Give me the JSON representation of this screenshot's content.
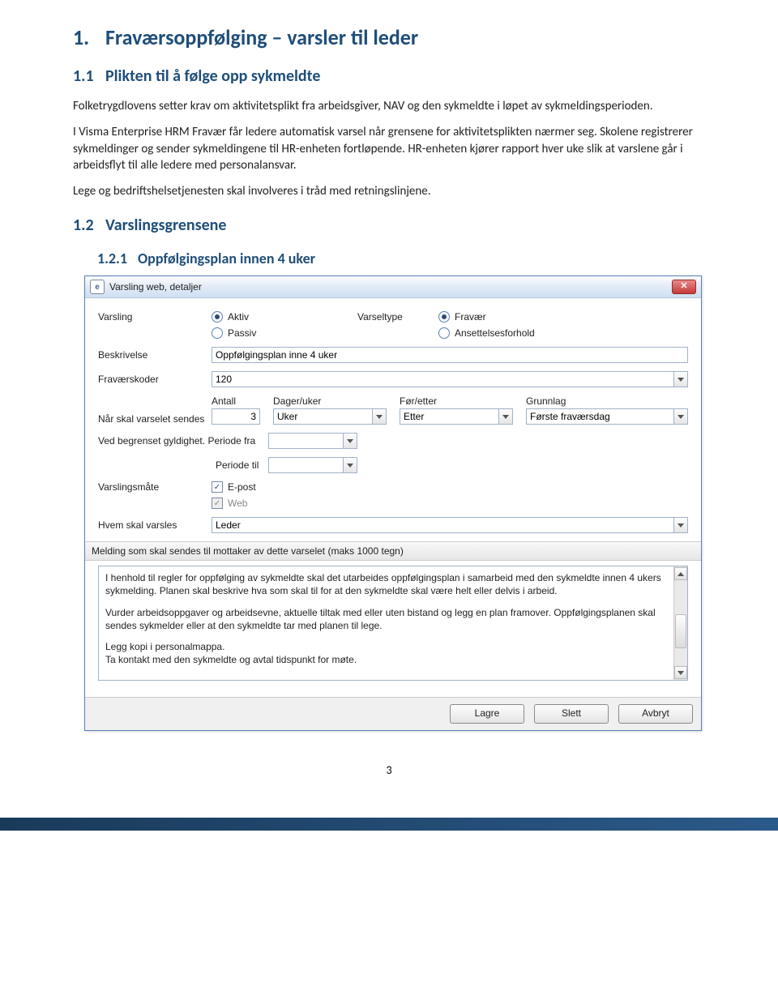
{
  "doc": {
    "h1_num": "1.",
    "h1_title": "Fraværsoppfølging – varsler til leder",
    "h2_num": "1.1",
    "h2_title": "Plikten til å følge opp sykmeldte",
    "para1": "Folketrygdlovens setter krav om aktivitetsplikt fra arbeidsgiver, NAV og den sykmeldte i løpet av sykmeldingsperioden.",
    "para2": "I Visma Enterprise HRM Fravær får ledere automatisk varsel når grensene for aktivitetsplikten nærmer seg.  Skolene registrerer sykmeldinger og sender sykmeldingene til HR-enheten fortløpende. HR-enheten kjører rapport hver uke slik at varslene går i arbeidsflyt til alle ledere med personalansvar.",
    "para3": "Lege og bedriftshelsetjenesten skal involveres i tråd med retningslinjene.",
    "h3_num": "1.2",
    "h3_title": "Varslingsgrensene",
    "h4_num": "1.2.1",
    "h4_title": "Oppfølgingsplan innen 4 uker",
    "page_number": "3"
  },
  "dialog": {
    "title": "Varsling web, detaljer",
    "labels": {
      "varsling": "Varsling",
      "varseltype": "Varseltype",
      "beskrivelse": "Beskrivelse",
      "fravaerskoder": "Fraværskoder",
      "naar": "Når skal varselet sendes",
      "ved_begrenset": "Ved begrenset gyldighet.",
      "periode_fra": "Periode fra",
      "periode_til": "Periode til",
      "varslingsmaate": "Varslingsmåte",
      "hvem": "Hvem skal varsles",
      "melding_header": "Melding som skal sendes til mottaker av dette varselet (maks 1000 tegn)"
    },
    "radios": {
      "aktiv": "Aktiv",
      "passiv": "Passiv",
      "fravar": "Fravær",
      "ansettelse": "Ansettelsesforhold"
    },
    "cols": {
      "antall": "Antall",
      "dager_uker": "Dager/uker",
      "for_etter": "Før/etter",
      "grunnlag": "Grunnlag"
    },
    "values": {
      "beskrivelse": "Oppfølgingsplan inne 4 uker",
      "fravaerskoder": "120",
      "antall": "3",
      "dager_uker": "Uker",
      "for_etter": "Etter",
      "grunnlag": "Første fraværsdag",
      "periode_fra": "",
      "periode_til": "",
      "hvem": "Leder"
    },
    "checks": {
      "epost": "E-post",
      "web": "Web"
    },
    "message": {
      "p1": "I henhold til regler for oppfølging av sykmeldte skal det utarbeides oppfølgingsplan i samarbeid med den sykmeldte innen 4 ukers sykmelding. Planen skal beskrive hva som skal til for at den sykmeldte skal være helt eller delvis i arbeid.",
      "p2": "Vurder arbeidsoppgaver og arbeidsevne, aktuelle tiltak med eller uten bistand og legg en plan framover. Oppfølgingsplanen skal sendes sykmelder eller at den sykmeldte tar med planen til lege.",
      "p3": "Legg kopi i personalmappa.",
      "p4": "Ta kontakt med den sykmeldte og avtal tidspunkt for møte."
    },
    "buttons": {
      "lagre": "Lagre",
      "slett": "Slett",
      "avbryt": "Avbryt"
    }
  }
}
